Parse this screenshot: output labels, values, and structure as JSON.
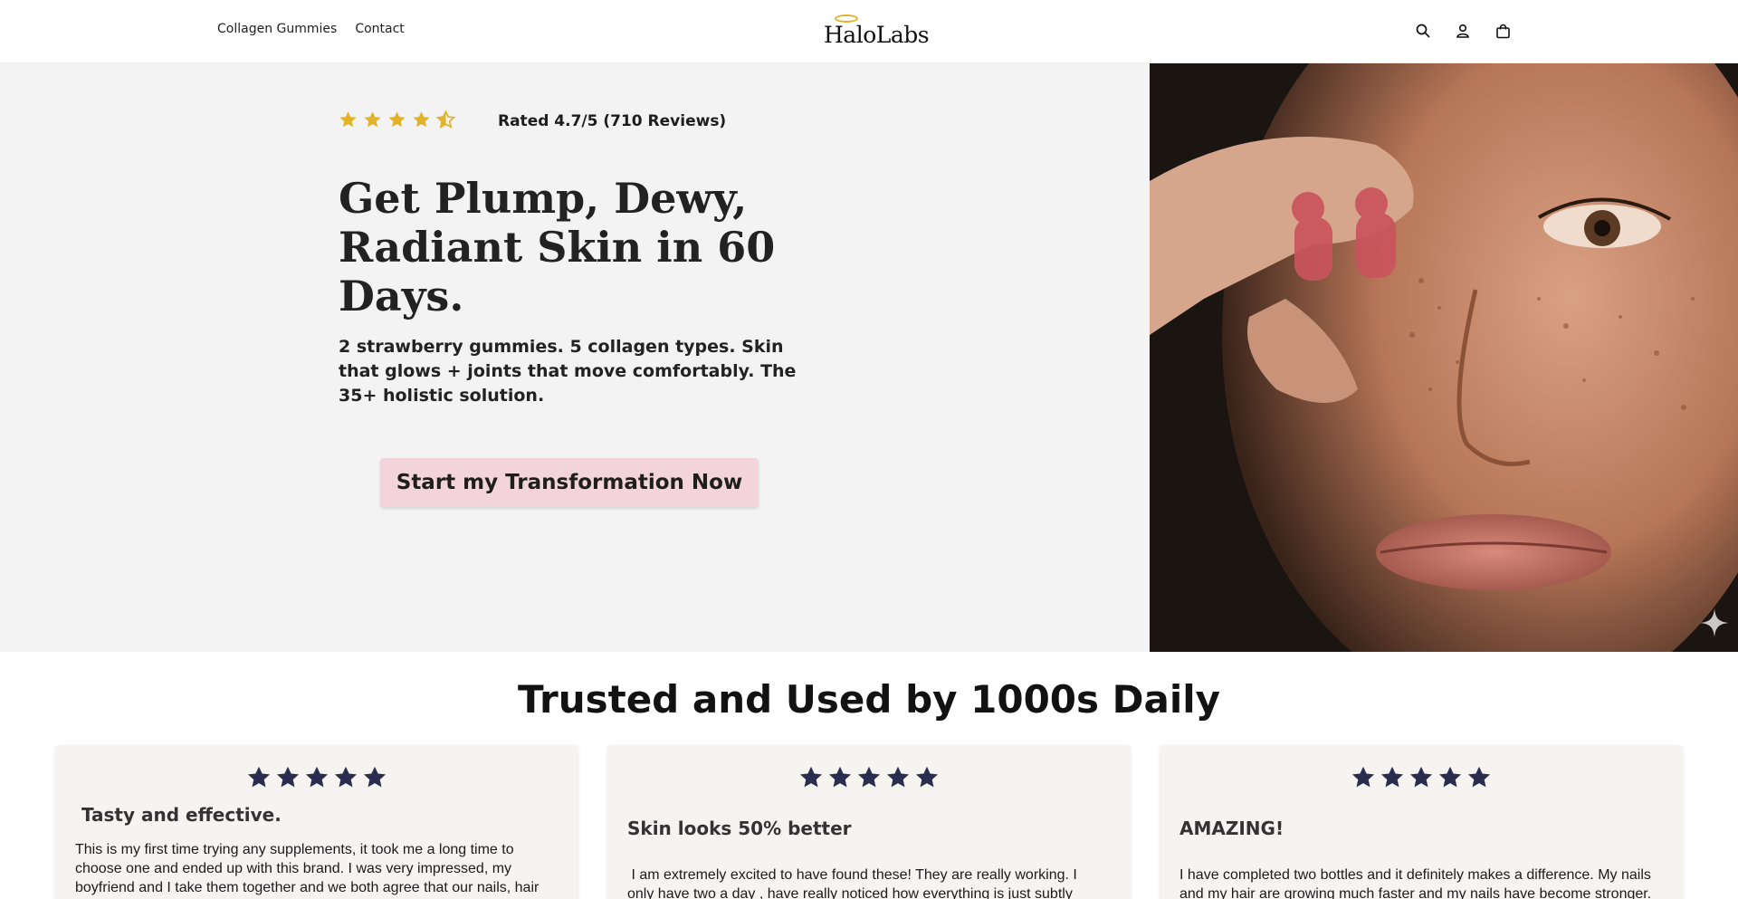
{
  "header": {
    "nav": [
      {
        "label": "Collagen Gummies"
      },
      {
        "label": "Contact"
      }
    ],
    "logo_text": "HaloLabs",
    "icons": [
      "search-icon",
      "account-icon",
      "cart-icon"
    ]
  },
  "hero": {
    "rating_stars": 4.5,
    "rated_text": "Rated 4.7/5 (710 Reviews)",
    "title": "Get Plump, Dewy, Radiant Skin in 60 Days.",
    "subtitle": "2 strawberry gummies. 5 collagen types. Skin that glows + joints that move comfortably. The 35+ holistic solution.",
    "cta_label": "Start my Transformation Now",
    "cta_color": "#f3d3dc",
    "star_color": "#e2b327"
  },
  "reviews": {
    "title": "Trusted and Used by 1000s Daily",
    "star_color": "#2b2d4f",
    "cards": [
      {
        "stars": 5,
        "title": " Tasty and effective.",
        "body": "This is my first time trying any supplements, it took me a long time to choose one and ended up with this brand. I was very impressed, my boyfriend and I take them together and we both agree that our nails, hair"
      },
      {
        "stars": 5,
        "title": "Skin looks 50% better",
        "body": " I am extremely excited to have found these! They are really working. I only have two a day , have really noticed how everything is just subtly"
      },
      {
        "stars": 5,
        "title": "AMAZING!",
        "body": "I have completed two bottles and it definitely makes a difference. My nails and my hair are growing much faster and my nails have become stronger."
      }
    ]
  }
}
